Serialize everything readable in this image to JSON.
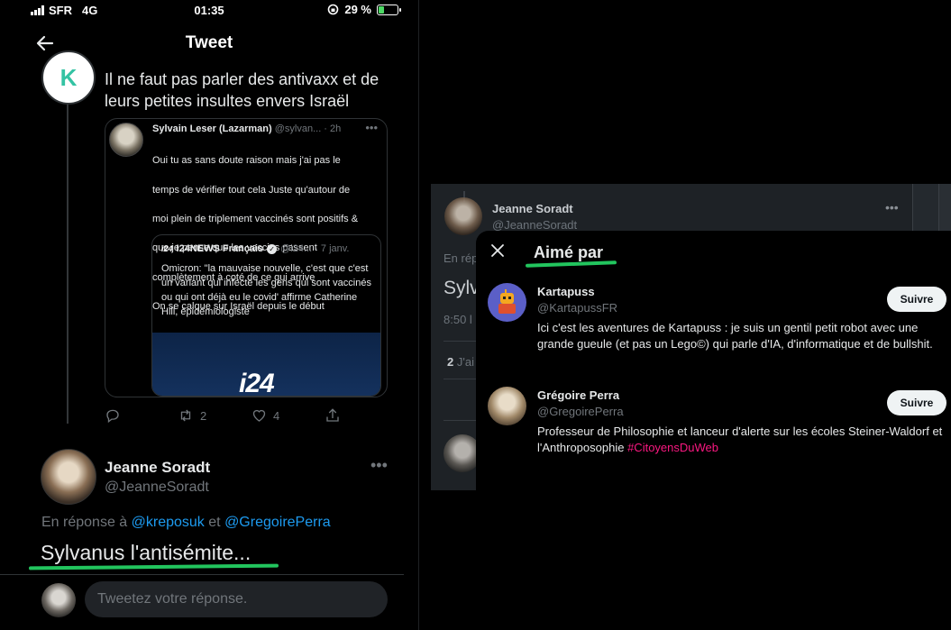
{
  "status_bar": {
    "carrier": "SFR",
    "network": "4G",
    "time": "01:35",
    "battery": "29 %",
    "battery_level": 0.29
  },
  "header": {
    "title": "Tweet"
  },
  "parent_tweet": {
    "avatar_letter": "K",
    "text": "Il ne faut pas parler des antivaxx et de leurs petites insultes envers Israël",
    "actions": {
      "retweets": "2",
      "likes": "4"
    }
  },
  "quoted_tweet": {
    "name": "Sylvain Leser (Lazarman)",
    "meta": "@sylvan... · 2h",
    "lines": [
      "Oui tu as sans doute raison mais j'ai pas le",
      "temps de vérifier tout cela Juste qu'autour de",
      "moi plein de triplement vaccinés sont positifs &",
      "que je pense que les vaccins passent",
      "complètement à coté de ce qui arrive",
      "On se calque sur Israël depuis le début"
    ]
  },
  "nested_quote": {
    "logo": "i24",
    "name": "I24NEWS Français",
    "meta": "@i24... · 7 janv.",
    "text": "Omicron: \"la mauvaise nouvelle, c'est que c'est un variant qui infecte les gens qui sont vaccinés ou qui ont déjà eu le covid' affirme Catherine Hill, épidémiologiste",
    "media_label": "i24"
  },
  "reply_tweet": {
    "name": "Jeanne Soradt",
    "handle": "@JeanneSoradt",
    "reply_prefix": "En réponse à",
    "mention1": "@kreposuk",
    "conj": "et",
    "mention2": "@GregoirePerra",
    "text": "Sylvanus l'antisémite..."
  },
  "composer": {
    "placeholder": "Tweetez votre réponse."
  },
  "desktop_bg": {
    "name": "Jeanne Soradt",
    "handle": "@JeanneSoradt",
    "reply_fragment": "En rép",
    "text_fragment": "Sylv",
    "time_fragment": "8:50 l",
    "likes_count": "2",
    "likes_fragment": "J'ai"
  },
  "likes_modal": {
    "title": "Aimé par",
    "users": [
      {
        "name": "Kartapuss",
        "handle": "@KartapussFR",
        "follow": "Suivre",
        "bio": "Ici c'est les aventures de Kartapuss : je suis un gentil petit robot avec une grande gueule (et pas un Lego©) qui parle d'IA, d'informatique et de bullshit.",
        "bio_tag": ""
      },
      {
        "name": "Grégoire Perra",
        "handle": "@GregoirePerra",
        "follow": "Suivre",
        "bio": "Professeur de Philosophie et lanceur d'alerte sur les écoles Steiner-Waldorf et l'Anthroposophie",
        "bio_tag": "#CitoyensDuWeb"
      }
    ]
  },
  "colors": {
    "accent_blue": "#1d9bf0",
    "hashtag_pink": "#f91880",
    "highlight_green": "#22c55e"
  }
}
